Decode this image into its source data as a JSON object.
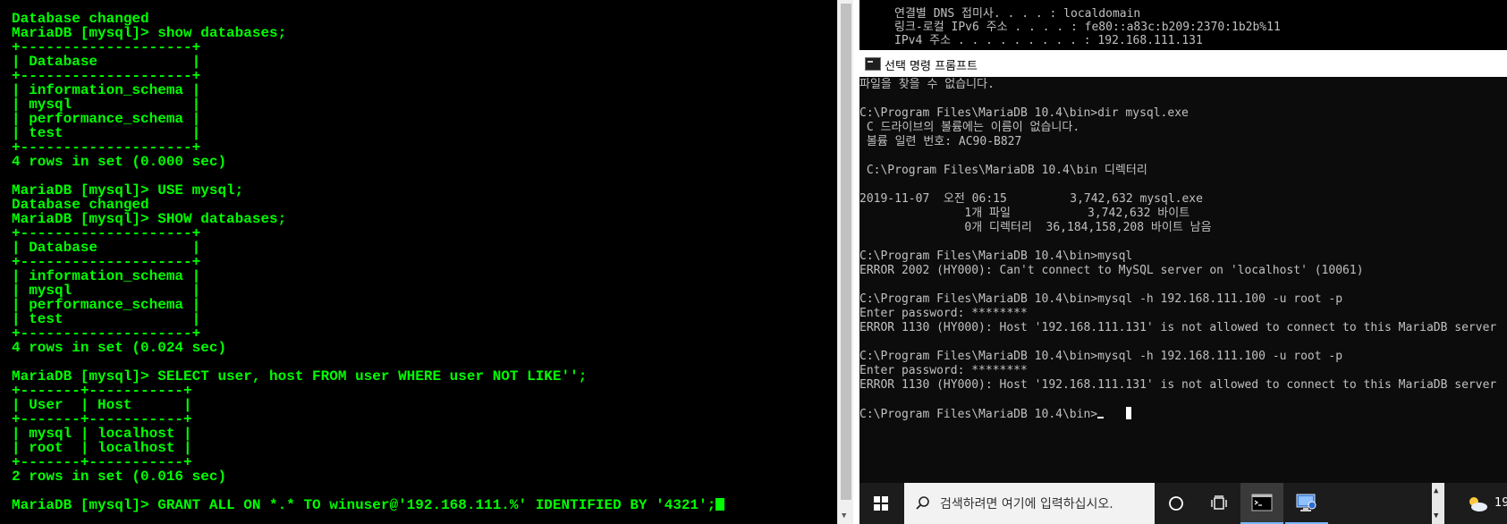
{
  "left_terminal": {
    "lines": [
      "Database changed",
      "MariaDB [mysql]> show databases;",
      "+--------------------+",
      "| Database           |",
      "+--------------------+",
      "| information_schema |",
      "| mysql              |",
      "| performance_schema |",
      "| test               |",
      "+--------------------+",
      "4 rows in set (0.000 sec)",
      "",
      "MariaDB [mysql]> USE mysql;",
      "Database changed",
      "MariaDB [mysql]> SHOW databases;",
      "+--------------------+",
      "| Database           |",
      "+--------------------+",
      "| information_schema |",
      "| mysql              |",
      "| performance_schema |",
      "| test               |",
      "+--------------------+",
      "4 rows in set (0.024 sec)",
      "",
      "MariaDB [mysql]> SELECT user, host FROM user WHERE user NOT LIKE'';",
      "+-------+-----------+",
      "| User  | Host      |",
      "+-------+-----------+",
      "| mysql | localhost |",
      "| root  | localhost |",
      "+-------+-----------+",
      "2 rows in set (0.016 sec)",
      ""
    ],
    "prompt_line": "MariaDB [mysql]> GRANT ALL ON *.* TO winuser@'192.168.111.%' IDENTIFIED BY '4321';",
    "text_color": "#00ff00"
  },
  "background_console": {
    "lines": [
      "연결별 DNS 접미사. . . . : localdomain",
      "링크-로컬 IPv6 주소 . . . . : fe80::a83c:b209:2370:1b2b%11",
      "IPv4 주소 . . . . . . . . . : 192.168.111.131"
    ]
  },
  "cmd_window": {
    "title": "선택 명령 프롬프트",
    "lines": [
      "파일을 찾을 수 없습니다.",
      "",
      "C:\\Program Files\\MariaDB 10.4\\bin>dir mysql.exe",
      " C 드라이브의 볼륨에는 이름이 없습니다.",
      " 볼륨 일련 번호: AC90-B827",
      "",
      " C:\\Program Files\\MariaDB 10.4\\bin 디렉터리",
      "",
      "2019-11-07  오전 06:15         3,742,632 mysql.exe",
      "               1개 파일           3,742,632 바이트",
      "               0개 디렉터리  36,184,158,208 바이트 남음",
      "",
      "C:\\Program Files\\MariaDB 10.4\\bin>mysql",
      "ERROR 2002 (HY000): Can't connect to MySQL server on 'localhost' (10061)",
      "",
      "C:\\Program Files\\MariaDB 10.4\\bin>mysql -h 192.168.111.100 -u root -p",
      "Enter password: ********",
      "ERROR 1130 (HY000): Host '192.168.111.131' is not allowed to connect to this MariaDB server",
      "",
      "C:\\Program Files\\MariaDB 10.4\\bin>mysql -h 192.168.111.100 -u root -p",
      "Enter password: ********",
      "ERROR 1130 (HY000): Host '192.168.111.131' is not allowed to connect to this MariaDB server",
      ""
    ],
    "prompt_line": "C:\\Program Files\\MariaDB 10.4\\bin>"
  },
  "taskbar": {
    "search_placeholder": "검색하려면 여기에 입력하십시오.",
    "tray_text": "19"
  }
}
